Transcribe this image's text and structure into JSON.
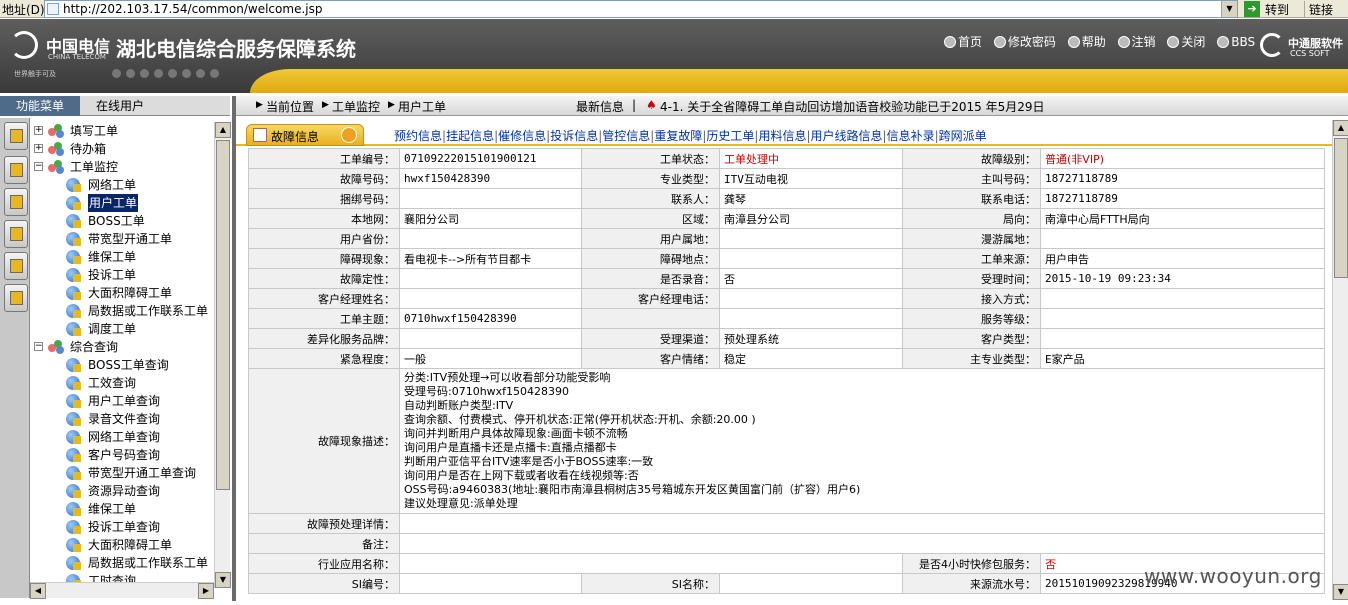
{
  "browser": {
    "address_label": "地址(D)",
    "url": "http://202.103.17.54/common/welcome.jsp",
    "go_label": "转到",
    "links_label": "链接"
  },
  "banner": {
    "brand_cn": "中国电信",
    "brand_en": "CHINA TELECOM",
    "slogan": "世界触手可及",
    "system_title": "湖北电信综合服务保障系统",
    "nav": [
      "首页",
      "修改密码",
      "帮助",
      "注销",
      "关闭",
      "BBS"
    ],
    "ccs_cn": "中通服软件",
    "ccs_en": "CCS SOFT"
  },
  "left_tabs": {
    "menu": "功能菜单",
    "online": "在线用户"
  },
  "tree": [
    {
      "label": "填写工单",
      "level": 0,
      "expanded": false
    },
    {
      "label": "待办箱",
      "level": 0,
      "expanded": false
    },
    {
      "label": "工单监控",
      "level": 0,
      "expanded": true
    },
    {
      "label": "网络工单",
      "level": 1
    },
    {
      "label": "用户工单",
      "level": 1,
      "selected": true
    },
    {
      "label": "BOSS工单",
      "level": 1
    },
    {
      "label": "带宽型开通工单",
      "level": 1
    },
    {
      "label": "维保工单",
      "level": 1
    },
    {
      "label": "投诉工单",
      "level": 1
    },
    {
      "label": "大面积障碍工单",
      "level": 1
    },
    {
      "label": "局数据或工作联系工单",
      "level": 1
    },
    {
      "label": "调度工单",
      "level": 1
    },
    {
      "label": "综合查询",
      "level": 0,
      "expanded": true
    },
    {
      "label": "BOSS工单查询",
      "level": 1
    },
    {
      "label": "工效查询",
      "level": 1
    },
    {
      "label": "用户工单查询",
      "level": 1
    },
    {
      "label": "录音文件查询",
      "level": 1
    },
    {
      "label": "网络工单查询",
      "level": 1
    },
    {
      "label": "客户号码查询",
      "level": 1
    },
    {
      "label": "带宽型开通工单查询",
      "level": 1
    },
    {
      "label": "资源异动查询",
      "level": 1
    },
    {
      "label": "维保工单",
      "level": 1
    },
    {
      "label": "投诉工单查询",
      "level": 1
    },
    {
      "label": "大面积障碍工单",
      "level": 1
    },
    {
      "label": "局数据或工作联系工单",
      "level": 1
    },
    {
      "label": "工时查询",
      "level": 1
    }
  ],
  "breadcrumb": {
    "prefix": "当前位置",
    "items": [
      "工单监控",
      "用户工单"
    ],
    "news_label": "最新信息",
    "news_text": "4-1. 关于全省障碍工单自动回访增加语音校验功能已于2015 年5月29日"
  },
  "tabs": {
    "active": "故障信息",
    "links": [
      "预约信息",
      "挂起信息",
      "催修信息",
      "投诉信息",
      "管控信息",
      "重复故障",
      "历史工单",
      "用料信息",
      "用户线路信息",
      "信息补录",
      "跨网派单"
    ]
  },
  "form": {
    "rows": [
      [
        [
          "工单编号：",
          "0710922201510190012​1"
        ],
        [
          "工单状态：",
          "工单处理中",
          "red"
        ],
        [
          "故障级别：",
          "普通(非VIP)",
          "red"
        ]
      ],
      [
        [
          "故障号码：",
          "hwxf150428390"
        ],
        [
          "专业类型：",
          "ITV互动电视"
        ],
        [
          "主叫号码：",
          "18727118789"
        ]
      ],
      [
        [
          "捆绑号码：",
          ""
        ],
        [
          "联系人：",
          "龚琴"
        ],
        [
          "联系电话：",
          "18727118789"
        ]
      ],
      [
        [
          "本地网：",
          "襄阳分公司"
        ],
        [
          "区域：",
          "南漳县分公司"
        ],
        [
          "局向：",
          "南漳中心局FTTH局向"
        ]
      ],
      [
        [
          "用户省份：",
          ""
        ],
        [
          "用户属地：",
          ""
        ],
        [
          "漫游属地：",
          ""
        ]
      ],
      [
        [
          "障碍现象：",
          "看电视卡-->所有节目都卡"
        ],
        [
          "障碍地点：",
          ""
        ],
        [
          "工单来源：",
          "用户申告"
        ]
      ],
      [
        [
          "故障定性：",
          ""
        ],
        [
          "是否录音：",
          "否"
        ],
        [
          "受理时间：",
          "2015-10-19 09:23:34"
        ]
      ],
      [
        [
          "客户经理姓名：",
          ""
        ],
        [
          "客户经理电话：",
          ""
        ],
        [
          "接入方式：",
          ""
        ]
      ],
      [
        [
          "工单主题：",
          "0710hwxf150428390"
        ],
        [
          "",
          ""
        ],
        [
          "服务等级：",
          ""
        ]
      ],
      [
        [
          "差异化服务品牌：",
          ""
        ],
        [
          "受理渠道：",
          "预处理系统"
        ],
        [
          "客户类型：",
          ""
        ]
      ],
      [
        [
          "紧急程度：",
          "一般"
        ],
        [
          "客户情绪：",
          "稳定"
        ],
        [
          "主专业类型：",
          "E家产品"
        ]
      ]
    ],
    "desc_label": "故障现象描述：",
    "desc_lines": [
      "分类:ITV预处理→可以收看部分功能受影响",
      "受理号码:0710hwxf150428390",
      "自动判断账户类型:ITV",
      "查询余额、付费模式、停开机状态:正常(停开机状态:开机、余额:20.00 )",
      "询问并判断用户具体故障现象:画面卡顿不流畅",
      "询问用户是直播卡还是点播卡:直播点播都卡",
      "判断用户亚信平台ITV速率是否小于BOSS速率:一致",
      "询问用户是否在上网下载或者收看在线视频等:否",
      "OSS号码:a9460383(地址:襄阳市南漳县桐树店35号箱城东开发区黄国富门前（扩容）用户6)",
      "建议处理意见:派单处理"
    ],
    "pre_label": "故障预处理详情：",
    "pre_value": "",
    "remark_label": "备注：",
    "remark_value": "",
    "industry_label": "行业应用名称：",
    "industry_value": "",
    "fast_label": "是否4小时快修包服务：",
    "fast_value": "否",
    "si_no_label": "SI编号：",
    "si_no_value": "",
    "si_name_label": "SI名称：",
    "si_name_value": "",
    "serial_label": "来源流水号：",
    "serial_value": "20151019092329819940"
  },
  "watermark": "www.wooyun.org"
}
